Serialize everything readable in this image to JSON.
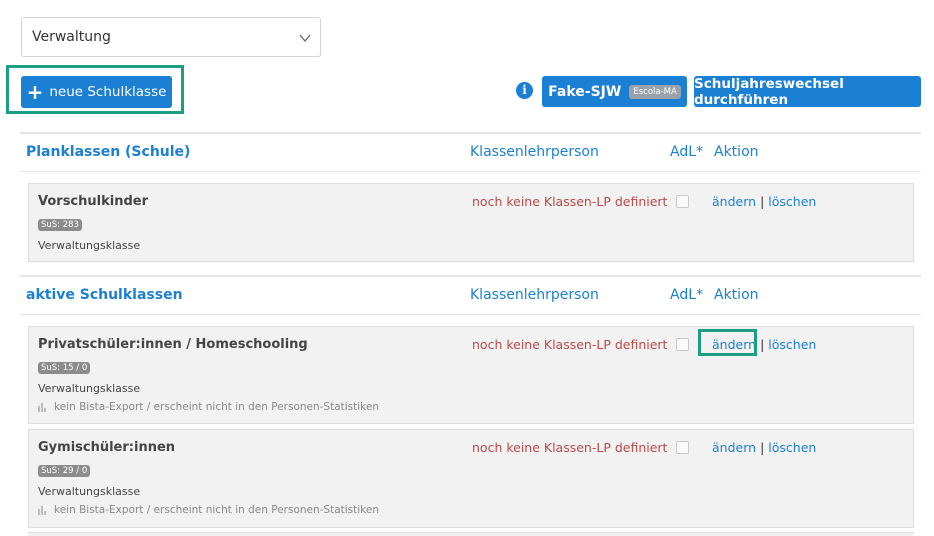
{
  "dropdown": {
    "value": "Verwaltung"
  },
  "toolbar": {
    "new_class_label": "neue Schulklasse",
    "fake_sjw_label": "Fake-SJW",
    "fake_sjw_badge": "Escola-MA",
    "sjw_label": "Schuljahreswechsel durchführen",
    "info_glyph": "i"
  },
  "sections": [
    {
      "title": "Planklassen (Schule)",
      "col_lp": "Klassenlehrperson",
      "col_adl": "AdL*",
      "col_action": "Aktion",
      "rows": [
        {
          "name": "Vorschulkinder",
          "sus": "SuS: 283",
          "type": "Verwaltungsklasse",
          "lp": "noch keine Klassen-LP definiert",
          "edit": "ändern",
          "delete": "löschen"
        }
      ]
    },
    {
      "title": "aktive Schulklassen",
      "col_lp": "Klassenlehrperson",
      "col_adl": "AdL*",
      "col_action": "Aktion",
      "rows": [
        {
          "name": "Privatschüler:innen / Homeschooling",
          "sus": "SuS: 15 / 0",
          "type": "Verwaltungsklasse",
          "note": "kein Bista-Export / erscheint nicht in den Personen-Statistiken",
          "lp": "noch keine Klassen-LP definiert",
          "edit": "ändern",
          "delete": "löschen"
        },
        {
          "name": "Gymischüler:innen",
          "sus": "SuS: 29 / 0",
          "type": "Verwaltungsklasse",
          "note": "kein Bista-Export / erscheint nicht in den Personen-Statistiken",
          "lp": "noch keine Klassen-LP definiert",
          "edit": "ändern",
          "delete": "löschen"
        }
      ]
    }
  ],
  "icons": {
    "select_arrow": "chevron-down-icon",
    "add": "plus-icon",
    "info": "info-icon",
    "no_export": "bar-chart-icon"
  },
  "colors": {
    "primary": "#1b7fd4",
    "highlight": "#1a9e85",
    "warning_text": "#b94a48"
  }
}
